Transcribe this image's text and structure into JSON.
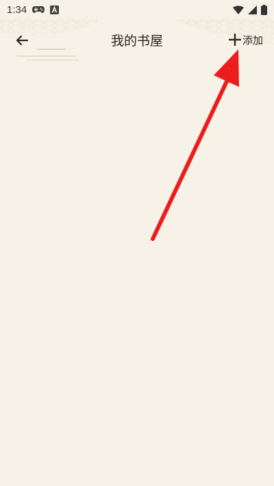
{
  "status_bar": {
    "time": "1:34",
    "icons_left": [
      "gamepad-icon",
      "a-square-icon"
    ],
    "icons_right": [
      "wifi-icon",
      "signal-icon",
      "battery-icon"
    ]
  },
  "header": {
    "title": "我的书屋",
    "back_icon": "arrow-left-icon",
    "add_icon": "plus-icon",
    "add_label": "添加"
  },
  "colors": {
    "background": "#f7f2e7",
    "text": "#2b2420",
    "annotation_arrow": "#ee1d1d"
  }
}
